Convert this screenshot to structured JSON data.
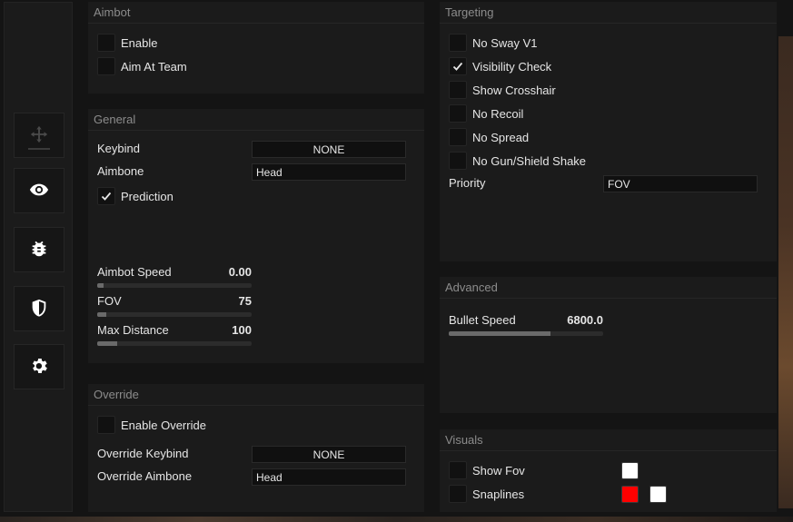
{
  "colors": {
    "check": "#e6e6e6",
    "swatch_white": "#ffffff",
    "swatch_red": "#ff0000"
  },
  "sidebar": {
    "items": [
      {
        "icon": "crosshair-icon",
        "active": false
      },
      {
        "icon": "eye-icon",
        "active": true
      },
      {
        "icon": "bug-icon",
        "active": true
      },
      {
        "icon": "shield-icon",
        "active": true
      },
      {
        "icon": "gear-icon",
        "active": true
      }
    ]
  },
  "aimbot": {
    "title": "Aimbot",
    "enable": {
      "label": "Enable",
      "checked": false
    },
    "aim_at_team": {
      "label": "Aim At Team",
      "checked": false
    }
  },
  "general": {
    "title": "General",
    "keybind": {
      "label": "Keybind",
      "value": "NONE"
    },
    "aimbone": {
      "label": "Aimbone",
      "value": "Head"
    },
    "prediction": {
      "label": "Prediction",
      "checked": true
    },
    "sliders": [
      {
        "label": "Aimbot Speed",
        "value": "0.00",
        "fraction": 0.04
      },
      {
        "label": "FOV",
        "value": "75",
        "fraction": 0.06
      },
      {
        "label": "Max Distance",
        "value": "100",
        "fraction": 0.13
      }
    ]
  },
  "override": {
    "title": "Override",
    "enable": {
      "label": "Enable Override",
      "checked": false
    },
    "keybind": {
      "label": "Override Keybind",
      "value": "NONE"
    },
    "aimbone": {
      "label": "Override Aimbone",
      "value": "Head"
    }
  },
  "targeting": {
    "title": "Targeting",
    "options": [
      {
        "label": "No Sway V1",
        "checked": false
      },
      {
        "label": "Visibility Check",
        "checked": true
      },
      {
        "label": "Show Crosshair",
        "checked": false
      },
      {
        "label": "No Recoil",
        "checked": false
      },
      {
        "label": "No Spread",
        "checked": false
      },
      {
        "label": "No Gun/Shield Shake",
        "checked": false
      }
    ],
    "priority": {
      "label": "Priority",
      "value": "FOV"
    }
  },
  "advanced": {
    "title": "Advanced",
    "bullet_speed": {
      "label": "Bullet Speed",
      "value": "6800.0",
      "fraction": 0.66
    }
  },
  "visuals": {
    "title": "Visuals",
    "show_fov": {
      "label": "Show Fov",
      "checked": false
    },
    "snaplines": {
      "label": "Snaplines",
      "checked": false
    }
  }
}
